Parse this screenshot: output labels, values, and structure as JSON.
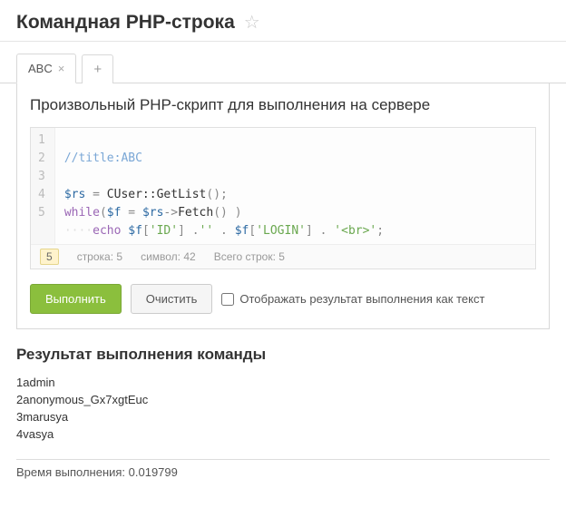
{
  "header": {
    "title": "Командная PHP-строка"
  },
  "tabs": {
    "active_label": "ABC"
  },
  "panel": {
    "title": "Произвольный PHP-скрипт для выполнения на сервере"
  },
  "editor": {
    "gutters": [
      "1",
      "2",
      "3",
      "4",
      "5"
    ],
    "line1_comment": "//title:ABC",
    "l3_var": "$rs",
    "l3_eq": " = ",
    "l3_call": "CUser::GetList",
    "l3_tail": "();",
    "l4_kw": "while",
    "l4_p1": "(",
    "l4_v1": "$f",
    "l4_eq": " = ",
    "l4_v2": "$rs",
    "l4_arrow": "->",
    "l4_fn": "Fetch",
    "l4_p2": "() )",
    "l5_indent": "····",
    "l5_kw": "echo",
    "l5_sp": " ",
    "l5_v": "$f",
    "l5_b1": "[",
    "l5_s1": "'ID'",
    "l5_b2": "] .",
    "l5_s2": "''",
    "l5_dot": " . ",
    "l5_v2": "$f",
    "l5_b3": "[",
    "l5_s3": "'LOGIN'",
    "l5_b4": "] . ",
    "l5_s4": "'<br>'",
    "l5_end": ";"
  },
  "status": {
    "current_line": "5",
    "line_label": "строка: 5",
    "col_label": "символ: 42",
    "total_label": "Всего строк: 5"
  },
  "actions": {
    "submit": "Выполнить",
    "clear": "Очистить",
    "as_text_label": "Отображать результат выполнения как текст"
  },
  "result": {
    "title": "Результат выполнения команды",
    "lines": [
      "1admin",
      "2anonymous_Gx7xgtEuc",
      "3marusya",
      "4vasya"
    ]
  },
  "footer": {
    "time_label": "Время выполнения: 0.019799"
  }
}
